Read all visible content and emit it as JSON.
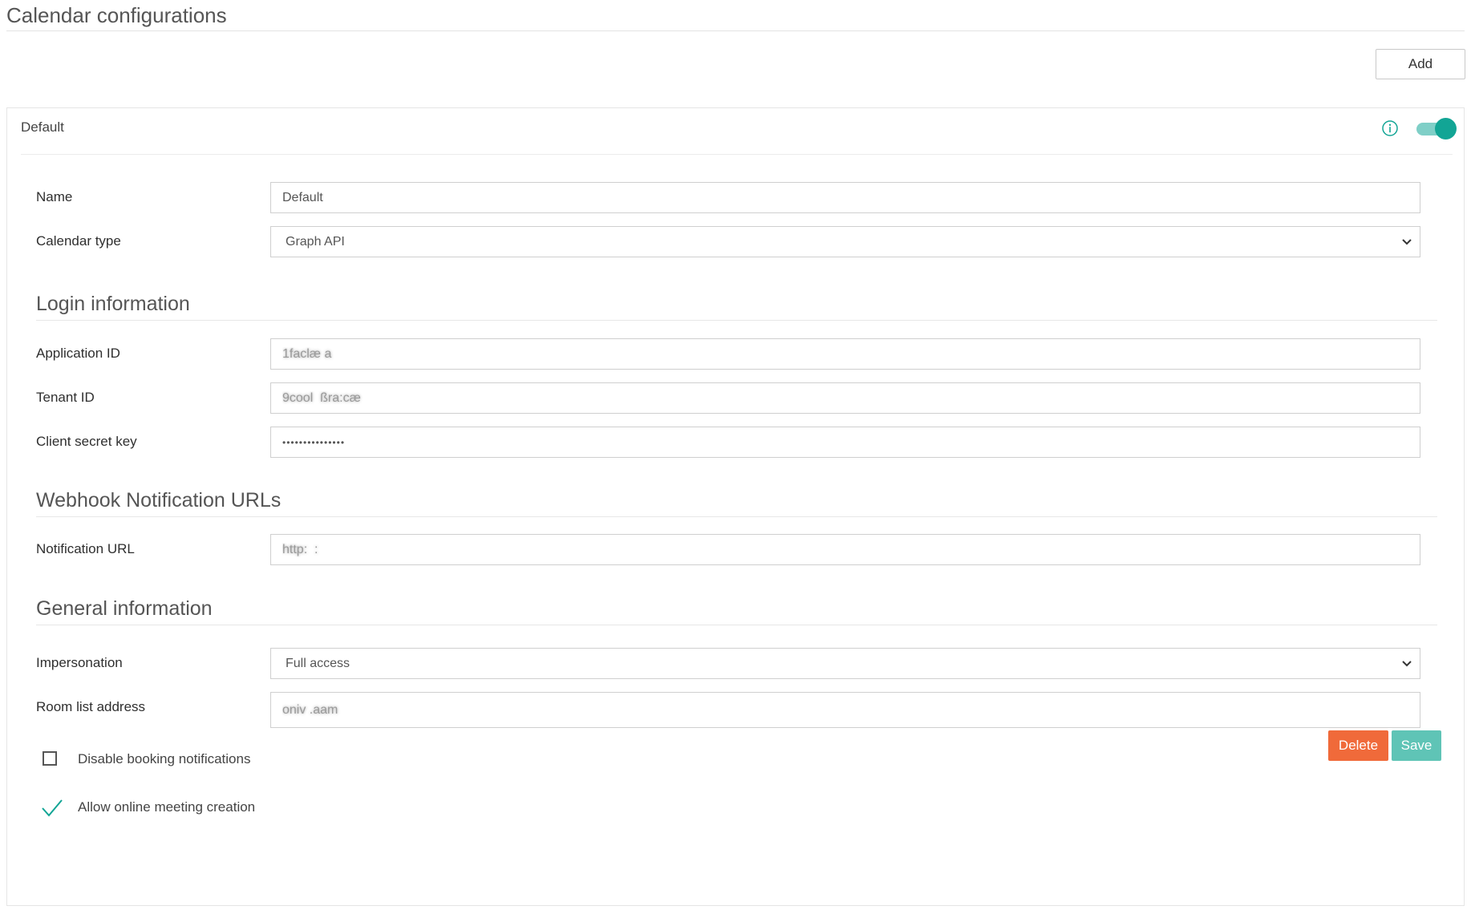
{
  "page": {
    "title": "Calendar configurations",
    "add_label": "Add"
  },
  "panel": {
    "title": "Default",
    "enabled": true,
    "accent_color": "#12a595",
    "icons": {
      "info": "info-icon",
      "toggle": "toggle-switch"
    }
  },
  "form": {
    "name": {
      "label": "Name",
      "value": "Default"
    },
    "calendar_type": {
      "label": "Calendar type",
      "selected": "Graph API"
    }
  },
  "login": {
    "heading": "Login information",
    "application_id": {
      "label": "Application ID",
      "value": "1faclæ a"
    },
    "tenant_id": {
      "label": "Tenant ID",
      "value": "9cool  ßra:cæ"
    },
    "client_secret": {
      "label": "Client secret key",
      "value": "•••••••••••••••"
    }
  },
  "webhook": {
    "heading": "Webhook Notification URLs",
    "notification_url": {
      "label": "Notification URL",
      "value": "http:  :"
    }
  },
  "general": {
    "heading": "General information",
    "impersonation": {
      "label": "Impersonation",
      "selected": "Full access"
    },
    "room_list_address": {
      "label": "Room list address",
      "value": "oniv .aam"
    }
  },
  "options": {
    "disable_booking_notifications": {
      "label": "Disable booking notifications",
      "checked": false
    },
    "allow_online_meeting_creation": {
      "label": "Allow online meeting creation",
      "checked": true
    }
  },
  "actions": {
    "delete_label": "Delete",
    "save_label": "Save",
    "delete_color": "#f06a3a",
    "save_color": "#5fc4b6"
  }
}
